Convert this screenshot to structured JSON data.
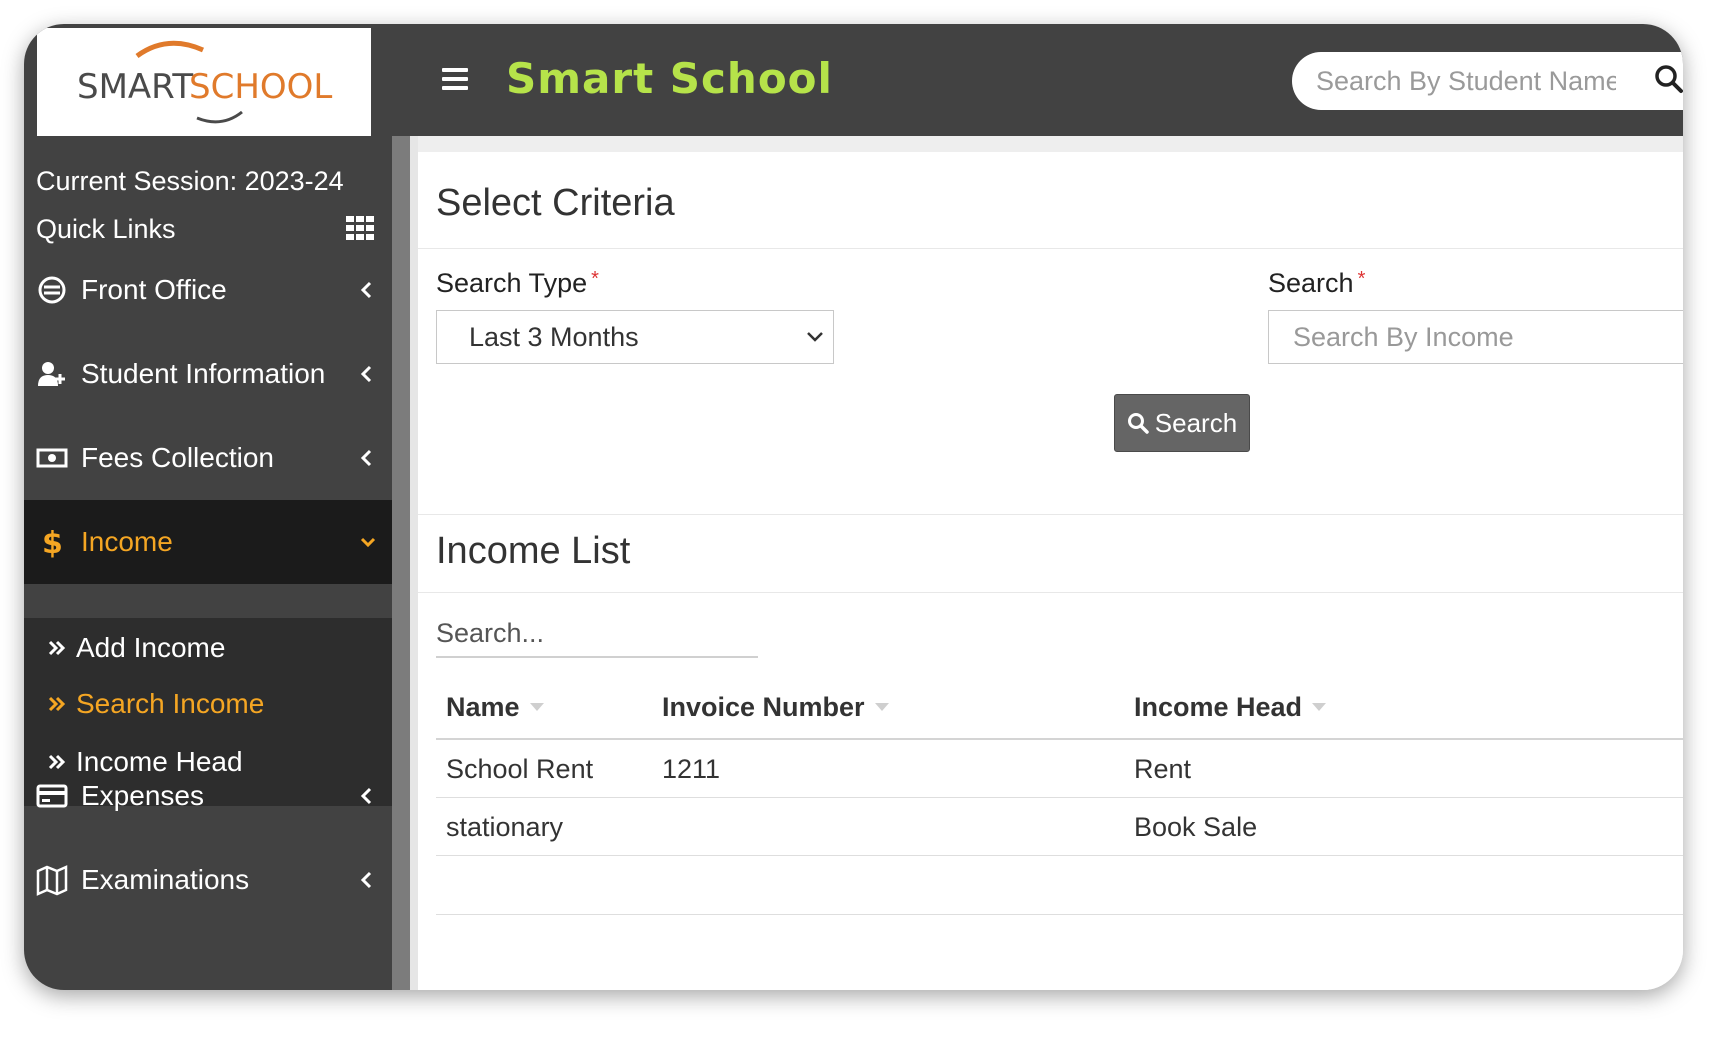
{
  "app": {
    "logo_text_smart": "SMART",
    "logo_text_school": "SCHOOL",
    "title": "Smart School",
    "student_search_placeholder": "Search By Student Name"
  },
  "sidebar": {
    "session": "Current Session: 2023-24",
    "quick_links": "Quick Links",
    "items": [
      {
        "label": "Front Office",
        "icon": "front-office-icon"
      },
      {
        "label": "Student Information",
        "icon": "user-plus-icon"
      },
      {
        "label": "Fees Collection",
        "icon": "money-icon"
      },
      {
        "label": "Income",
        "icon": "dollar-icon",
        "active": true
      },
      {
        "label": "Expenses",
        "icon": "credit-card-icon"
      },
      {
        "label": "Examinations",
        "icon": "map-icon"
      }
    ],
    "income_submenu": [
      {
        "label": "Add Income"
      },
      {
        "label": "Search Income",
        "active": true
      },
      {
        "label": "Income Head"
      }
    ]
  },
  "criteria": {
    "title": "Select Criteria",
    "search_type_label": "Search Type",
    "search_type_value": "Last 3 Months",
    "search_label": "Search",
    "search_placeholder": "Search By Income",
    "required_mark": "*",
    "search_button": "Search"
  },
  "income_list": {
    "title": "Income List",
    "search_placeholder": "Search...",
    "columns": [
      "Name",
      "Invoice Number",
      "Income Head"
    ],
    "rows": [
      {
        "name": "School Rent",
        "invoice": "1211",
        "head": "Rent"
      },
      {
        "name": "stationary",
        "invoice": "",
        "head": "Book Sale"
      }
    ]
  },
  "colors": {
    "topbar": "#424242",
    "brand_green": "#b6e34a",
    "accent_orange": "#f5a623",
    "sidebar_active": "#1b1b1b",
    "button_gray": "#656565"
  }
}
